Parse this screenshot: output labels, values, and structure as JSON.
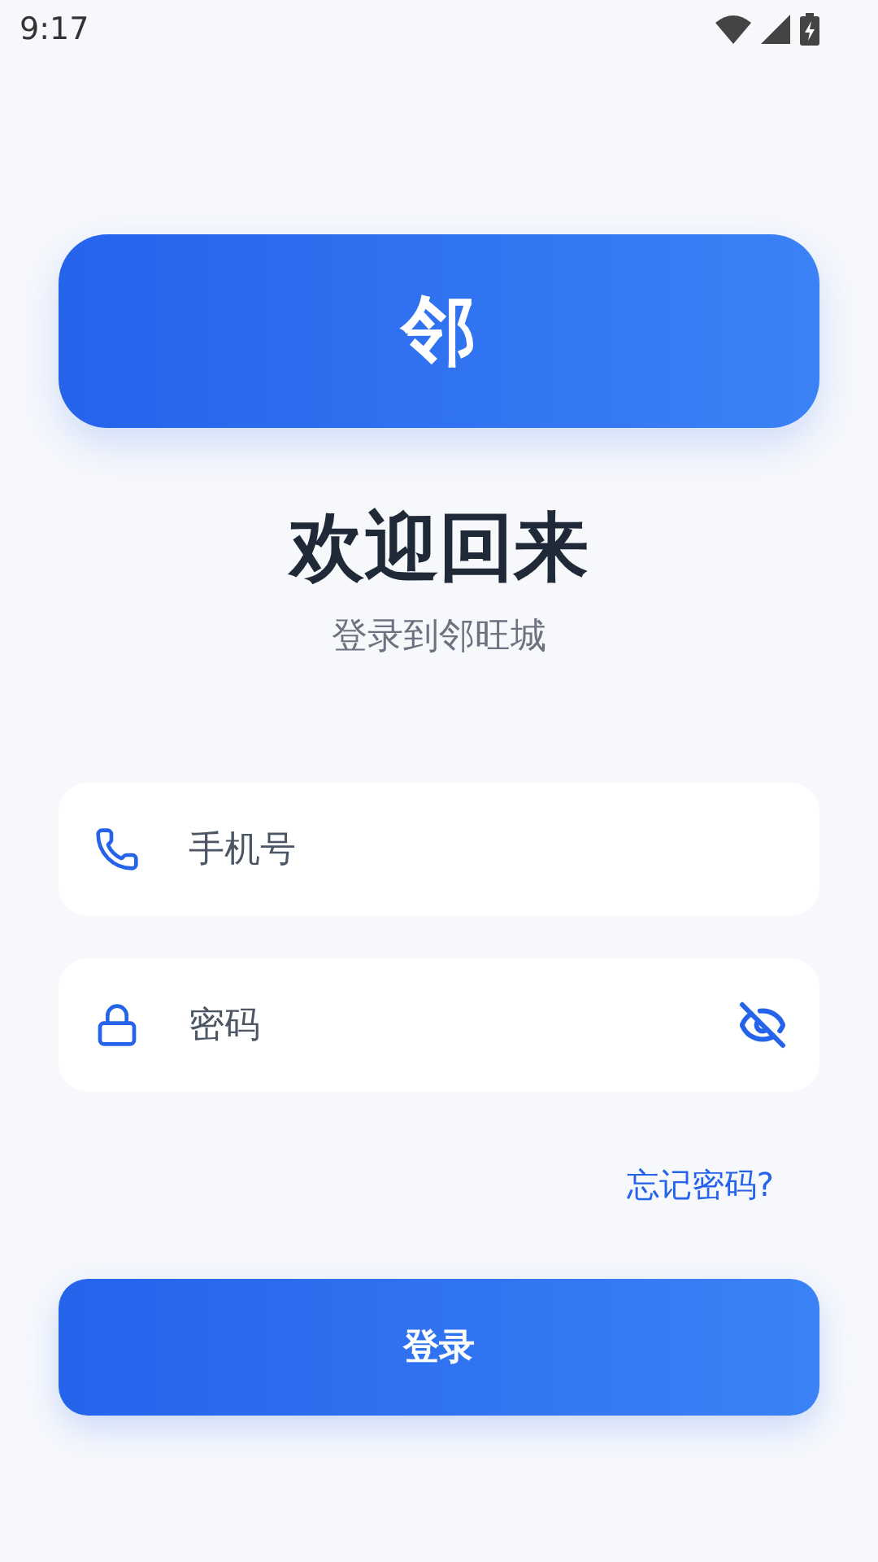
{
  "status_bar": {
    "time": "9:17"
  },
  "logo": {
    "text": "邻"
  },
  "title": "欢迎回来",
  "subtitle": "登录到邻旺城",
  "fields": [
    {
      "kind": "phone",
      "placeholder": "手机号"
    },
    {
      "kind": "password",
      "placeholder": "密码",
      "password_visible": false
    }
  ],
  "forgot_link": "忘记密码?",
  "login_button": "登录"
}
